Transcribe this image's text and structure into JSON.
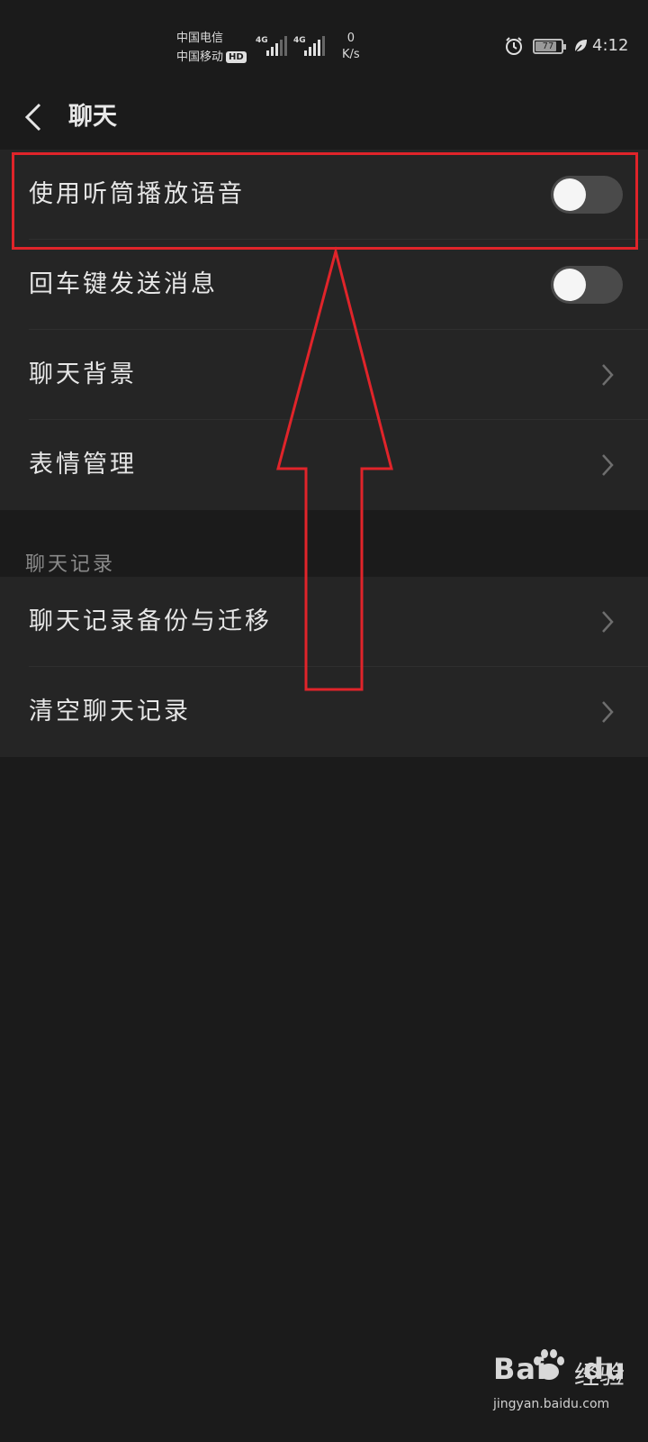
{
  "status_bar": {
    "carrier_1": "中国电信",
    "carrier_2": "中国移动",
    "hd_badge": "HD",
    "network_1": "4G",
    "network_2": "4G",
    "speed_value": "0",
    "speed_unit": "K/s",
    "battery_level": "77",
    "time": "4:12"
  },
  "header": {
    "title": "聊天"
  },
  "settings": {
    "group1": [
      {
        "label": "使用听筒播放语音",
        "control": "toggle",
        "on": false
      },
      {
        "label": "回车键发送消息",
        "control": "toggle",
        "on": false
      },
      {
        "label": "聊天背景",
        "control": "chevron"
      },
      {
        "label": "表情管理",
        "control": "chevron"
      }
    ],
    "section_title": "聊天记录",
    "group2": [
      {
        "label": "聊天记录备份与迁移",
        "control": "chevron"
      },
      {
        "label": "清空聊天记录",
        "control": "chevron"
      }
    ]
  },
  "annotation": {
    "color": "#e0242a"
  },
  "watermark": {
    "brand_left": "Bai",
    "brand_right": "du",
    "suffix": "经验",
    "url": "jingyan.baidu.com"
  }
}
